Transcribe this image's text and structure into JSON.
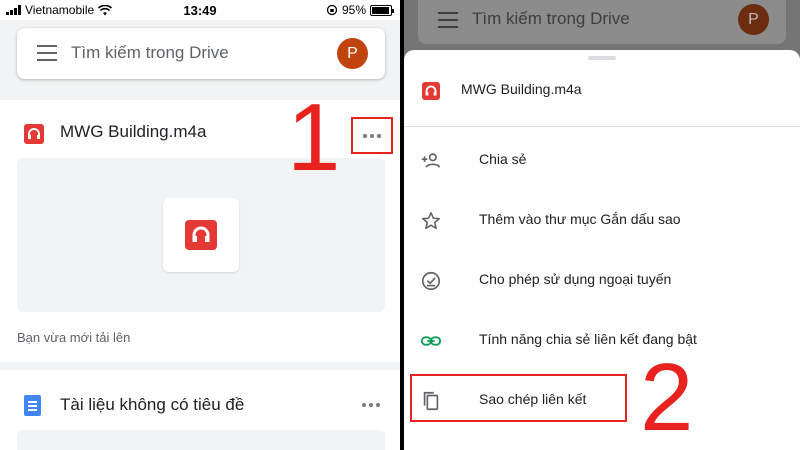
{
  "status_bar": {
    "carrier": "Vietnamobile",
    "time": "13:49",
    "battery": "95%",
    "battery_level": 0.95
  },
  "drive": {
    "search_placeholder": "Tìm kiếm trong Drive",
    "avatar_letter": "P",
    "file": {
      "name": "MWG Building.m4a",
      "subtitle": "Bạn vừa mới tải lên"
    },
    "doc": {
      "name": "Tài liệu không có tiêu đề"
    }
  },
  "sheet": {
    "title": "MWG Building.m4a",
    "items": [
      {
        "label": "Chia sẻ",
        "icon": "person-add-icon"
      },
      {
        "label": "Thêm vào thư mục Gắn dấu sao",
        "icon": "star-icon"
      },
      {
        "label": "Cho phép sử dụng ngoại tuyến",
        "icon": "offline-check-icon"
      },
      {
        "label": "Tính năng chia sẻ liên kết đang bật",
        "icon": "link-icon"
      },
      {
        "label": "Sao chép liên kết",
        "icon": "copy-icon"
      }
    ]
  },
  "annotations": {
    "step1": "1",
    "step2": "2",
    "highlight_color": "#e8231f"
  },
  "colors": {
    "audio_icon": "#e53935",
    "doc_icon": "#4285f4",
    "avatar": "#c1440e",
    "link_icon": "#0f9d58"
  }
}
